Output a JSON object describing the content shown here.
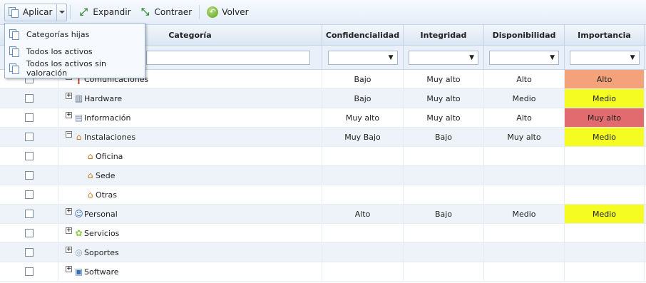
{
  "toolbar": {
    "apply_label": "Aplicar",
    "expand_label": "Expandir",
    "collapse_label": "Contraer",
    "back_label": "Volver"
  },
  "menu": {
    "items": [
      {
        "label": "Categorías hijas"
      },
      {
        "label": "Todos los activos"
      },
      {
        "label": "Todos los activos sin valoración"
      }
    ]
  },
  "columns": {
    "category": "Categoría",
    "confidentiality": "Confidencialidad",
    "integrity": "Integridad",
    "availability": "Disponibilidad",
    "importance": "Importancia"
  },
  "filters": {
    "category_value": "",
    "confidentiality_value": "",
    "integrity_value": "",
    "availability_value": "",
    "importance_value": "",
    "dropdown_glyph": "▼"
  },
  "colors": {
    "importance_alto": "#f4a27a",
    "importance_medio": "#f5fc22",
    "importance_muy_alto": "#e26b6f"
  },
  "rows": [
    {
      "category": "Comunicaciones",
      "icon": "antenna-icon",
      "toggle": "−",
      "level": 0,
      "conf": "Bajo",
      "integ": "Muy alto",
      "disp": "Alto",
      "imp": "Alto",
      "imp_color": "#f4a27a"
    },
    {
      "category": "Hardware",
      "icon": "server-icon",
      "toggle": "+",
      "level": 0,
      "conf": "Bajo",
      "integ": "Muy alto",
      "disp": "Medio",
      "imp": "Medio",
      "imp_color": "#f5fc22"
    },
    {
      "category": "Información",
      "icon": "document-icon",
      "toggle": "+",
      "level": 0,
      "conf": "Muy alto",
      "integ": "Muy alto",
      "disp": "Alto",
      "imp": "Muy alto",
      "imp_color": "#e26b6f"
    },
    {
      "category": "Instalaciones",
      "icon": "house-icon",
      "toggle": "−",
      "level": 0,
      "conf": "Muy Bajo",
      "integ": "Bajo",
      "disp": "Muy alto",
      "imp": "Medio",
      "imp_color": "#f5fc22"
    },
    {
      "category": "Oficina",
      "icon": "house-icon",
      "toggle": "",
      "level": 1,
      "conf": "",
      "integ": "",
      "disp": "",
      "imp": "",
      "imp_color": ""
    },
    {
      "category": "Sede",
      "icon": "house-icon",
      "toggle": "",
      "level": 1,
      "conf": "",
      "integ": "",
      "disp": "",
      "imp": "",
      "imp_color": ""
    },
    {
      "category": "Otras",
      "icon": "house-icon",
      "toggle": "",
      "level": 1,
      "conf": "",
      "integ": "",
      "disp": "",
      "imp": "",
      "imp_color": ""
    },
    {
      "category": "Personal",
      "icon": "person-icon",
      "toggle": "+",
      "level": 0,
      "conf": "Alto",
      "integ": "Bajo",
      "disp": "Medio",
      "imp": "Medio",
      "imp_color": "#f5fc22"
    },
    {
      "category": "Servicios",
      "icon": "services-icon",
      "toggle": "+",
      "level": 0,
      "conf": "",
      "integ": "",
      "disp": "",
      "imp": "",
      "imp_color": ""
    },
    {
      "category": "Soportes",
      "icon": "disc-icon",
      "toggle": "+",
      "level": 0,
      "conf": "",
      "integ": "",
      "disp": "",
      "imp": "",
      "imp_color": ""
    },
    {
      "category": "Software",
      "icon": "window-icon",
      "toggle": "+",
      "level": 0,
      "conf": "",
      "integ": "",
      "disp": "",
      "imp": "",
      "imp_color": ""
    }
  ]
}
